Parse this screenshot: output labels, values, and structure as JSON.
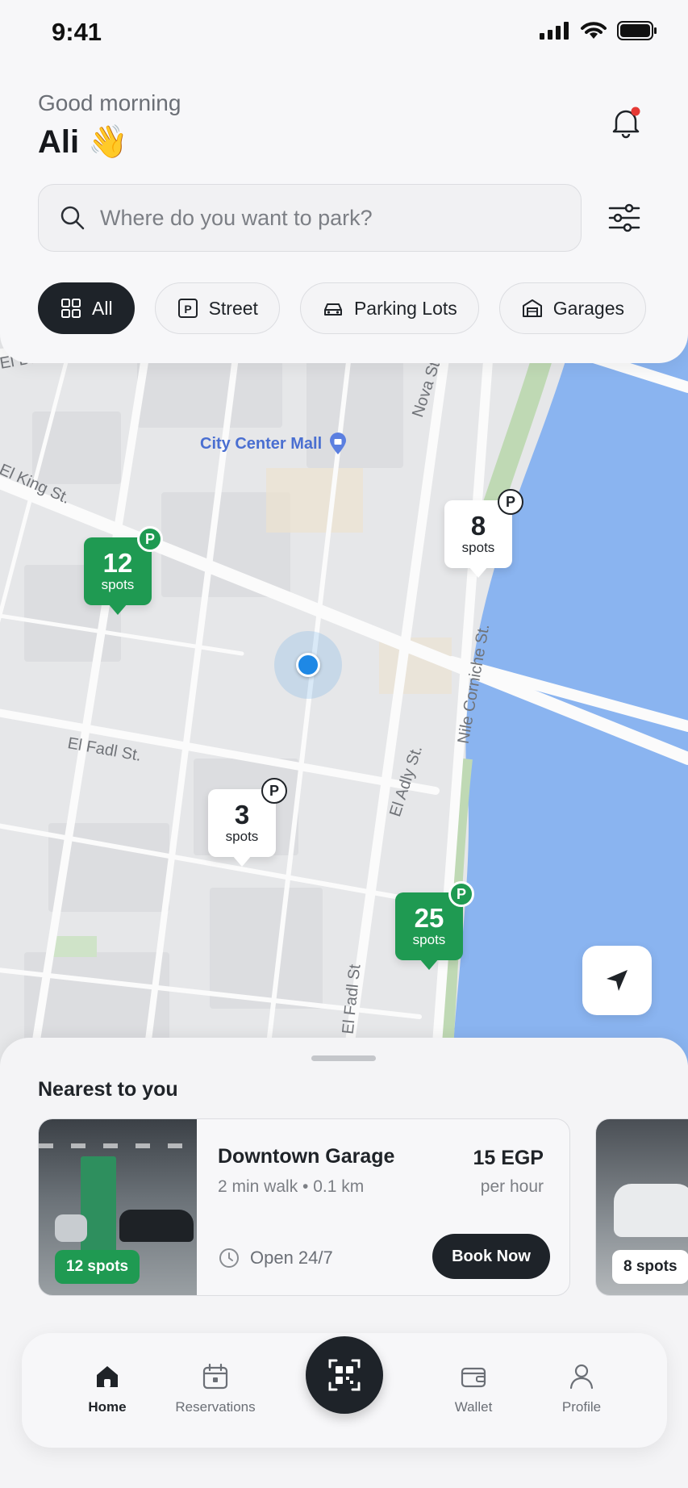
{
  "status": {
    "time": "9:41"
  },
  "header": {
    "greeting": "Good morning",
    "username": "Ali 👋",
    "search_placeholder": "Where do you want to park?"
  },
  "chips": [
    {
      "label": "All",
      "icon": "grid-icon",
      "active": true
    },
    {
      "label": "Street",
      "icon": "parking-sign-icon"
    },
    {
      "label": "Parking Lots",
      "icon": "car-icon"
    },
    {
      "label": "Garages",
      "icon": "garage-icon"
    }
  ],
  "map": {
    "poi": "City Center Mall",
    "roads": [
      "El Baan Al Ahaly St.",
      "El King St.",
      "El Fadl St.",
      "El Fadl St",
      "Nile Corniche St.",
      "El Adly St.",
      "Nova St."
    ],
    "markers": [
      {
        "count": "12",
        "label": "spots",
        "style": "green"
      },
      {
        "count": "8",
        "label": "spots",
        "style": "white"
      },
      {
        "count": "3",
        "label": "spots",
        "style": "white"
      },
      {
        "count": "25",
        "label": "spots",
        "style": "green"
      }
    ],
    "badge_letter": "P"
  },
  "sheet": {
    "title": "Nearest to you",
    "cards": [
      {
        "name": "Downtown Garage",
        "meta": "2 min walk • 0.1 km",
        "price": "15 EGP",
        "unit": "per hour",
        "hours": "Open 24/7",
        "spots": "12 spots",
        "button": "Book Now"
      },
      {
        "spots": "8 spots"
      }
    ]
  },
  "nav": {
    "items": [
      {
        "label": "Home",
        "icon": "home-icon",
        "active": true
      },
      {
        "label": "Reservations",
        "icon": "calendar-icon"
      },
      {
        "label": "Scan",
        "icon": "qr-scan-icon"
      },
      {
        "label": "Wallet",
        "icon": "wallet-icon"
      },
      {
        "label": "Profile",
        "icon": "profile-icon"
      }
    ]
  },
  "colors": {
    "accent": "#1f9a52",
    "dark": "#1e2329",
    "location": "#1e88e5",
    "water": "#8ab4f0"
  }
}
